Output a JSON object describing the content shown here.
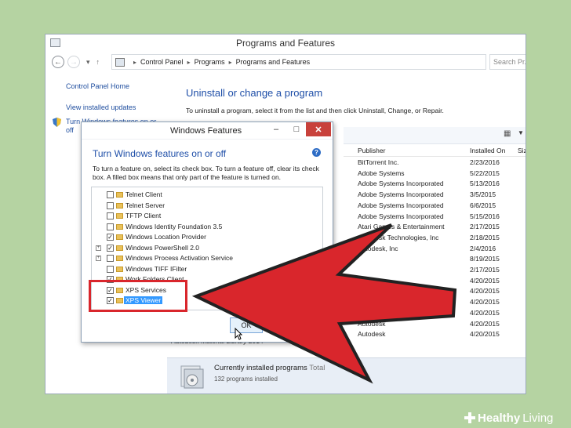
{
  "main_window": {
    "title": "Programs and Features",
    "breadcrumb": [
      "Control Panel",
      "Programs",
      "Programs and Features"
    ],
    "search_placeholder": "Search Pr...",
    "left_pane": {
      "home": "Control Panel Home",
      "updates": "View installed updates",
      "features_line1": "Turn Windows features on or",
      "features_line2": "off"
    },
    "heading": "Uninstall or change a program",
    "instructions": "To uninstall a program, select it from the list and then click Uninstall, Change, or Repair.",
    "columns": {
      "publisher": "Publisher",
      "installed_on": "Installed On",
      "size": "Siz"
    },
    "rows": [
      {
        "publisher": "BitTorrent Inc.",
        "date": "2/23/2016"
      },
      {
        "publisher": "Adobe Systems",
        "date": "5/22/2015"
      },
      {
        "publisher": "Adobe Systems Incorporated",
        "date": "5/13/2016"
      },
      {
        "publisher": "Adobe Systems Incorporated",
        "date": "3/5/2015"
      },
      {
        "publisher": "Adobe Systems Incorporated",
        "date": "6/6/2015"
      },
      {
        "publisher": "Adobe Systems Incorporated",
        "date": "5/15/2016"
      },
      {
        "publisher": "Atari Games & Entertainment",
        "date": "2/17/2015"
      },
      {
        "publisher": "Autodesk Technologies, Inc",
        "date": "2/18/2015"
      },
      {
        "publisher": "Autodesk, Inc",
        "date": "2/4/2016"
      },
      {
        "publisher": "",
        "date": "8/19/2015"
      },
      {
        "publisher": "",
        "date": "2/17/2015"
      },
      {
        "publisher": "",
        "date": "4/20/2015"
      },
      {
        "publisher": "",
        "date": "4/20/2015"
      },
      {
        "publisher": "",
        "date": "4/20/2015"
      },
      {
        "publisher": "",
        "date": "4/20/2015"
      },
      {
        "publisher": "Autodesk",
        "date": "4/20/2015"
      },
      {
        "publisher": "Autodesk",
        "date": "4/20/2015"
      }
    ],
    "partial_row_name": "Autodesk Material Library 2014",
    "footer": {
      "title": "Currently installed programs",
      "title_suffix": "Total",
      "count": "132 programs installed"
    }
  },
  "dialog": {
    "title": "Windows Features",
    "heading": "Turn Windows features on or off",
    "description": "To turn a feature on, select its check box. To turn a feature off, clear its check box. A filled box means that only part of the feature is turned on.",
    "features": [
      {
        "label": "Telnet Client",
        "checked": false,
        "expandable": false
      },
      {
        "label": "Telnet Server",
        "checked": false,
        "expandable": false
      },
      {
        "label": "TFTP Client",
        "checked": false,
        "expandable": false
      },
      {
        "label": "Windows Identity Foundation 3.5",
        "checked": false,
        "expandable": false
      },
      {
        "label": "Windows Location Provider",
        "checked": true,
        "expandable": false
      },
      {
        "label": "Windows PowerShell 2.0",
        "checked": true,
        "expandable": true
      },
      {
        "label": "Windows Process Activation Service",
        "checked": false,
        "expandable": true
      },
      {
        "label": "Windows TIFF IFilter",
        "checked": false,
        "expandable": false
      },
      {
        "label": "Work Folders Client",
        "checked": true,
        "expandable": false
      },
      {
        "label": "XPS Services",
        "checked": true,
        "expandable": false
      },
      {
        "label": "XPS Viewer",
        "checked": true,
        "expandable": false,
        "selected": true
      }
    ],
    "ok_label": "OK"
  },
  "brand": {
    "healthy": "Healthy",
    "living": "Living"
  },
  "colors": {
    "arrow": "#d9262c",
    "link": "#1f4e9f",
    "background": "#b5d3a2"
  }
}
